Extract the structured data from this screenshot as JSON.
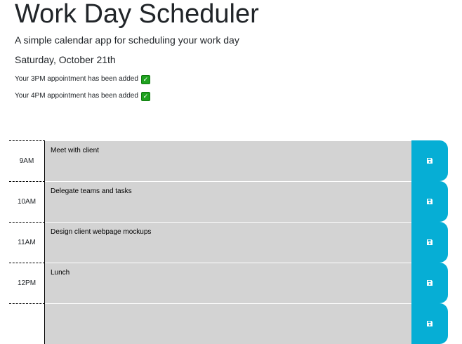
{
  "header": {
    "title": "Work Day Scheduler",
    "lead": "A simple calendar app for scheduling your work day",
    "current_day": "Saturday, October 21th"
  },
  "notifications": [
    {
      "text": "Your 3PM appointment has been added",
      "icon": "check-mark-icon"
    },
    {
      "text": "Your 4PM appointment has been added",
      "icon": "check-mark-icon"
    }
  ],
  "rows": [
    {
      "hour": "9AM",
      "description": "Meet with client",
      "save_icon": "floppy-disk-icon"
    },
    {
      "hour": "10AM",
      "description": "Delegate teams and tasks",
      "save_icon": "floppy-disk-icon"
    },
    {
      "hour": "11AM",
      "description": "Design client webpage mockups",
      "save_icon": "floppy-disk-icon"
    },
    {
      "hour": "12PM",
      "description": "Lunch",
      "save_icon": "floppy-disk-icon"
    },
    {
      "hour": "",
      "description": "",
      "save_icon": "floppy-disk-icon"
    }
  ],
  "colors": {
    "past_block": "#d3d3d3",
    "save_button": "#06aed5",
    "check_mark": "#1fa21f"
  }
}
